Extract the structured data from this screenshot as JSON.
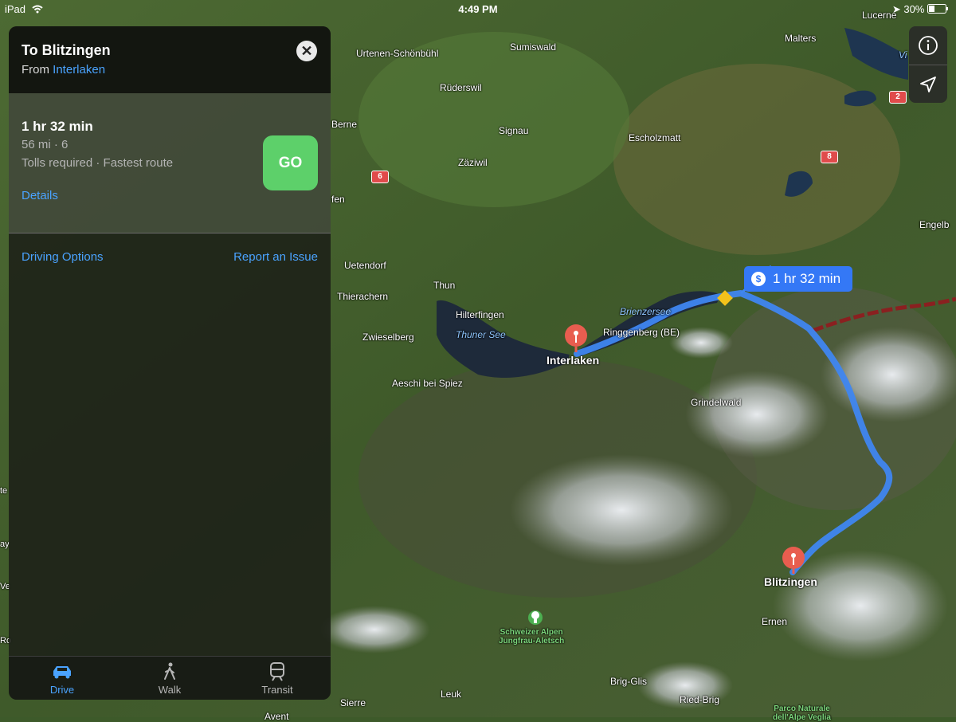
{
  "status_bar": {
    "device": "iPad",
    "time": "4:49 PM",
    "battery": "30%"
  },
  "panel": {
    "title": "To Blitzingen",
    "from_prefix": "From",
    "from_place": "Interlaken",
    "route": {
      "duration": "1 hr 32 min",
      "distance": "56 mi · 6",
      "notes": "Tolls required · Fastest route",
      "details_link": "Details",
      "go_label": "GO"
    },
    "driving_options": "Driving Options",
    "report_issue": "Report an Issue",
    "tabs": [
      {
        "label": "Drive",
        "icon": "car-icon",
        "active": true
      },
      {
        "label": "Walk",
        "icon": "walk-icon",
        "active": false
      },
      {
        "label": "Transit",
        "icon": "train-icon",
        "active": false
      }
    ]
  },
  "map": {
    "route_callout": "1 hr 32 min",
    "route_color": "#3478f6",
    "places": {
      "urtenen": "Urtenen-Schönbühl",
      "sumiswald": "Sumiswald",
      "malters": "Malters",
      "luzern": "Lucerne",
      "ruderswil": "Rüderswil",
      "berne": "Berne",
      "signau": "Signau",
      "escholzmatt": "Escholzmatt",
      "zaziwil": "Zäziwil",
      "engelberg": "Engelb",
      "uetendorf": "Uetendorf",
      "thun": "Thun",
      "thierachern": "Thierachern",
      "hilterfingen": "Hilterfingen",
      "zwieselberg": "Zwieselberg",
      "ringgenberg": "Ringgenberg (BE)",
      "interlaken": "Interlaken",
      "aeschi": "Aeschi bei Spiez",
      "grindelwald": "Grindelwald",
      "blitzingen": "Blitzingen",
      "ernen": "Ernen",
      "brig": "Brig-Glis",
      "riedbrig": "Ried-Brig",
      "leuk": "Leuk",
      "sierre": "Sierre",
      "avent": "Avent"
    },
    "water": {
      "thunersee": "Thuner See",
      "brienzersee": "Brienzersee",
      "vier": "Vi"
    },
    "parks": {
      "jungfrau_line1": "Schweizer Alpen",
      "jungfrau_line2": "Jungfrau-Aletsch",
      "binn_line1": "Parco Naturale",
      "binn_line2": "dell'Alpe Veglia"
    },
    "edge_fragments": [
      "fen",
      "te",
      "ay",
      "Ve",
      "Ro"
    ],
    "road_shields": [
      "6",
      "8",
      "2"
    ]
  }
}
